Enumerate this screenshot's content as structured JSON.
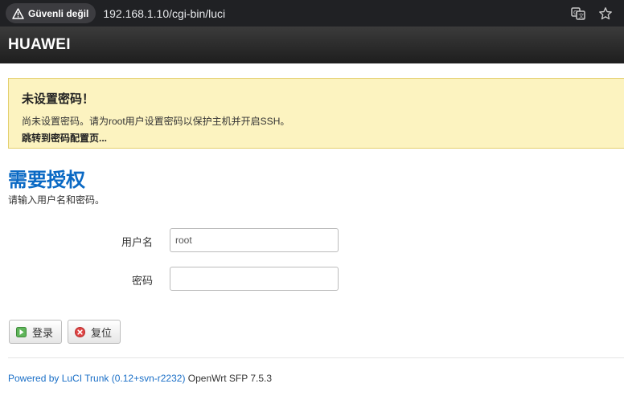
{
  "browser": {
    "security_label": "Güvenli değil",
    "url": "192.168.1.10/cgi-bin/luci",
    "icons": [
      "warning-icon",
      "translate-icon",
      "star-icon"
    ]
  },
  "header": {
    "brand": "HUAWEI"
  },
  "alert": {
    "title": "未设置密码！",
    "message": "尚未设置密码。请为root用户设置密码以保护主机并开启SSH。",
    "link": "跳转到密码配置页..."
  },
  "auth": {
    "title": "需要授权",
    "description": "请输入用户名和密码。"
  },
  "form": {
    "username_label": "用户名",
    "username_value": "root",
    "password_label": "密码",
    "password_value": ""
  },
  "buttons": {
    "login": "登录",
    "reset": "复位"
  },
  "footer": {
    "link_text": "Powered by LuCI Trunk (0.12+svn-r2232)",
    "suffix": " OpenWrt SFP 7.5.3"
  },
  "colors": {
    "accent": "#0a69c4",
    "alert_bg": "#fcf3c0",
    "header_bg": "#1e1e1e"
  }
}
